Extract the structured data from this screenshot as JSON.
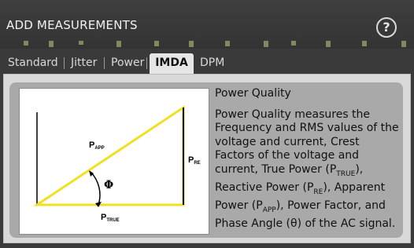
{
  "dialog": {
    "title": "ADD MEASUREMENTS",
    "help_icon": "question-circle-icon"
  },
  "tabs": [
    {
      "label": "Standard",
      "active": false
    },
    {
      "label": "Jitter",
      "active": false
    },
    {
      "label": "Power",
      "active": false
    },
    {
      "label": "IMDA",
      "active": true
    },
    {
      "label": "DPM",
      "active": false
    }
  ],
  "figure": {
    "p_app": "P",
    "p_app_sub": "APP",
    "p_re": "P",
    "p_re_sub": "RE",
    "p_true": "P",
    "p_true_sub": "TRUE",
    "angle": "Φ"
  },
  "description": {
    "title": "Power Quality",
    "part1": "Power Quality measures the Frequency and RMS values of the voltage and current, Crest Factors of the voltage and current, True Power (P",
    "sub1": "TRUE",
    "part2": "), Reactive Power (P",
    "sub2": "RE",
    "part3": "), Apparent Power (P",
    "sub3": "APP",
    "part4": "), Power Factor, and Phase Angle (θ) of the AC signal."
  },
  "colors": {
    "accent_yellow": "#f0e020",
    "tab_active_bg": "#e6e6e6",
    "header_bg": "#3a3a3a"
  }
}
